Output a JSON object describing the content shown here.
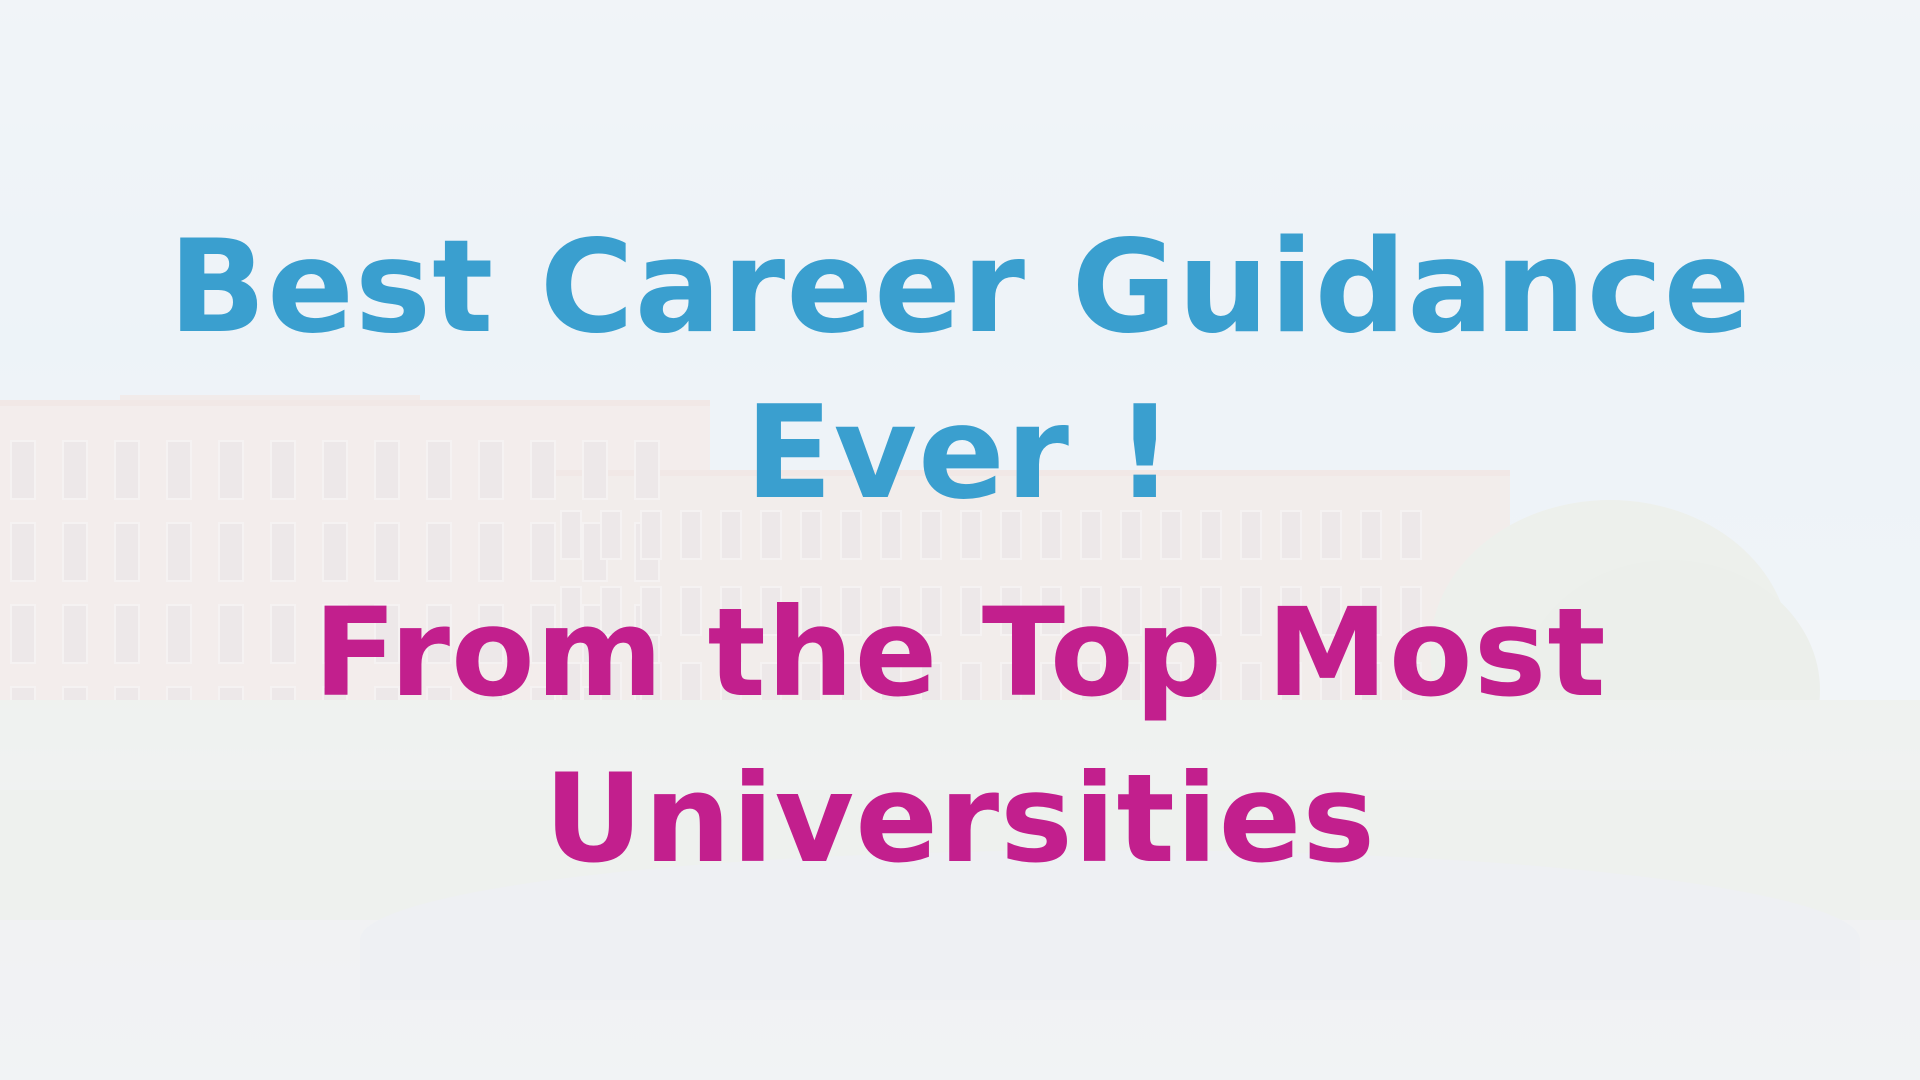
{
  "slide": {
    "headline": {
      "line1": "Best Career Guidance",
      "line2": "Ever !",
      "color": "#3a9fcf"
    },
    "subline": {
      "line1": "From the Top Most",
      "line2": "Universities",
      "color": "#c21f8d"
    },
    "background_image": "faded-university-campus-photo"
  }
}
